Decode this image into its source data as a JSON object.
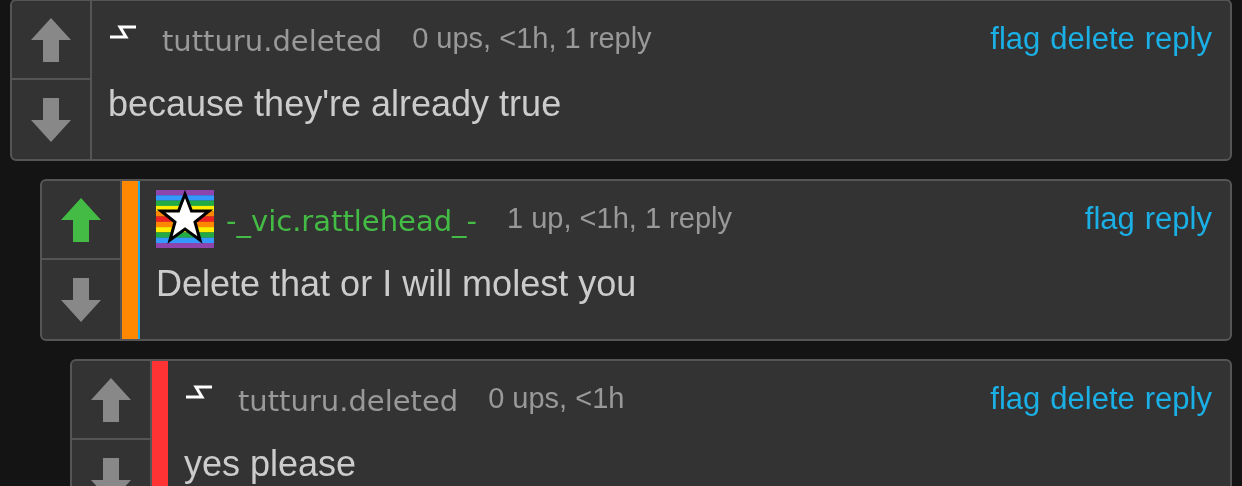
{
  "comments": [
    {
      "avatar": {
        "kind": "bolt"
      },
      "username": "tutturu.deleted",
      "username_highlighted": false,
      "meta": "0 ups, <1h, 1 reply",
      "actions": [
        "flag",
        "delete",
        "reply"
      ],
      "body": "because they're already true",
      "upvoted": false,
      "focused": false
    },
    {
      "avatar": {
        "kind": "rainbow-star"
      },
      "username": "-_vic.rattlehead_-",
      "username_highlighted": true,
      "meta": "1 up, <1h, 1 reply",
      "actions": [
        "flag",
        "reply"
      ],
      "body": "Delete that or I will molest you",
      "upvoted": true,
      "focused": true,
      "color": "#ff8800"
    },
    {
      "avatar": {
        "kind": "bolt"
      },
      "username": "tutturu.deleted",
      "username_highlighted": false,
      "meta": "0 ups, <1h",
      "actions": [
        "flag",
        "delete",
        "reply"
      ],
      "body": "yes please",
      "upvoted": false,
      "focused": false,
      "color": "#ff3333"
    }
  ]
}
